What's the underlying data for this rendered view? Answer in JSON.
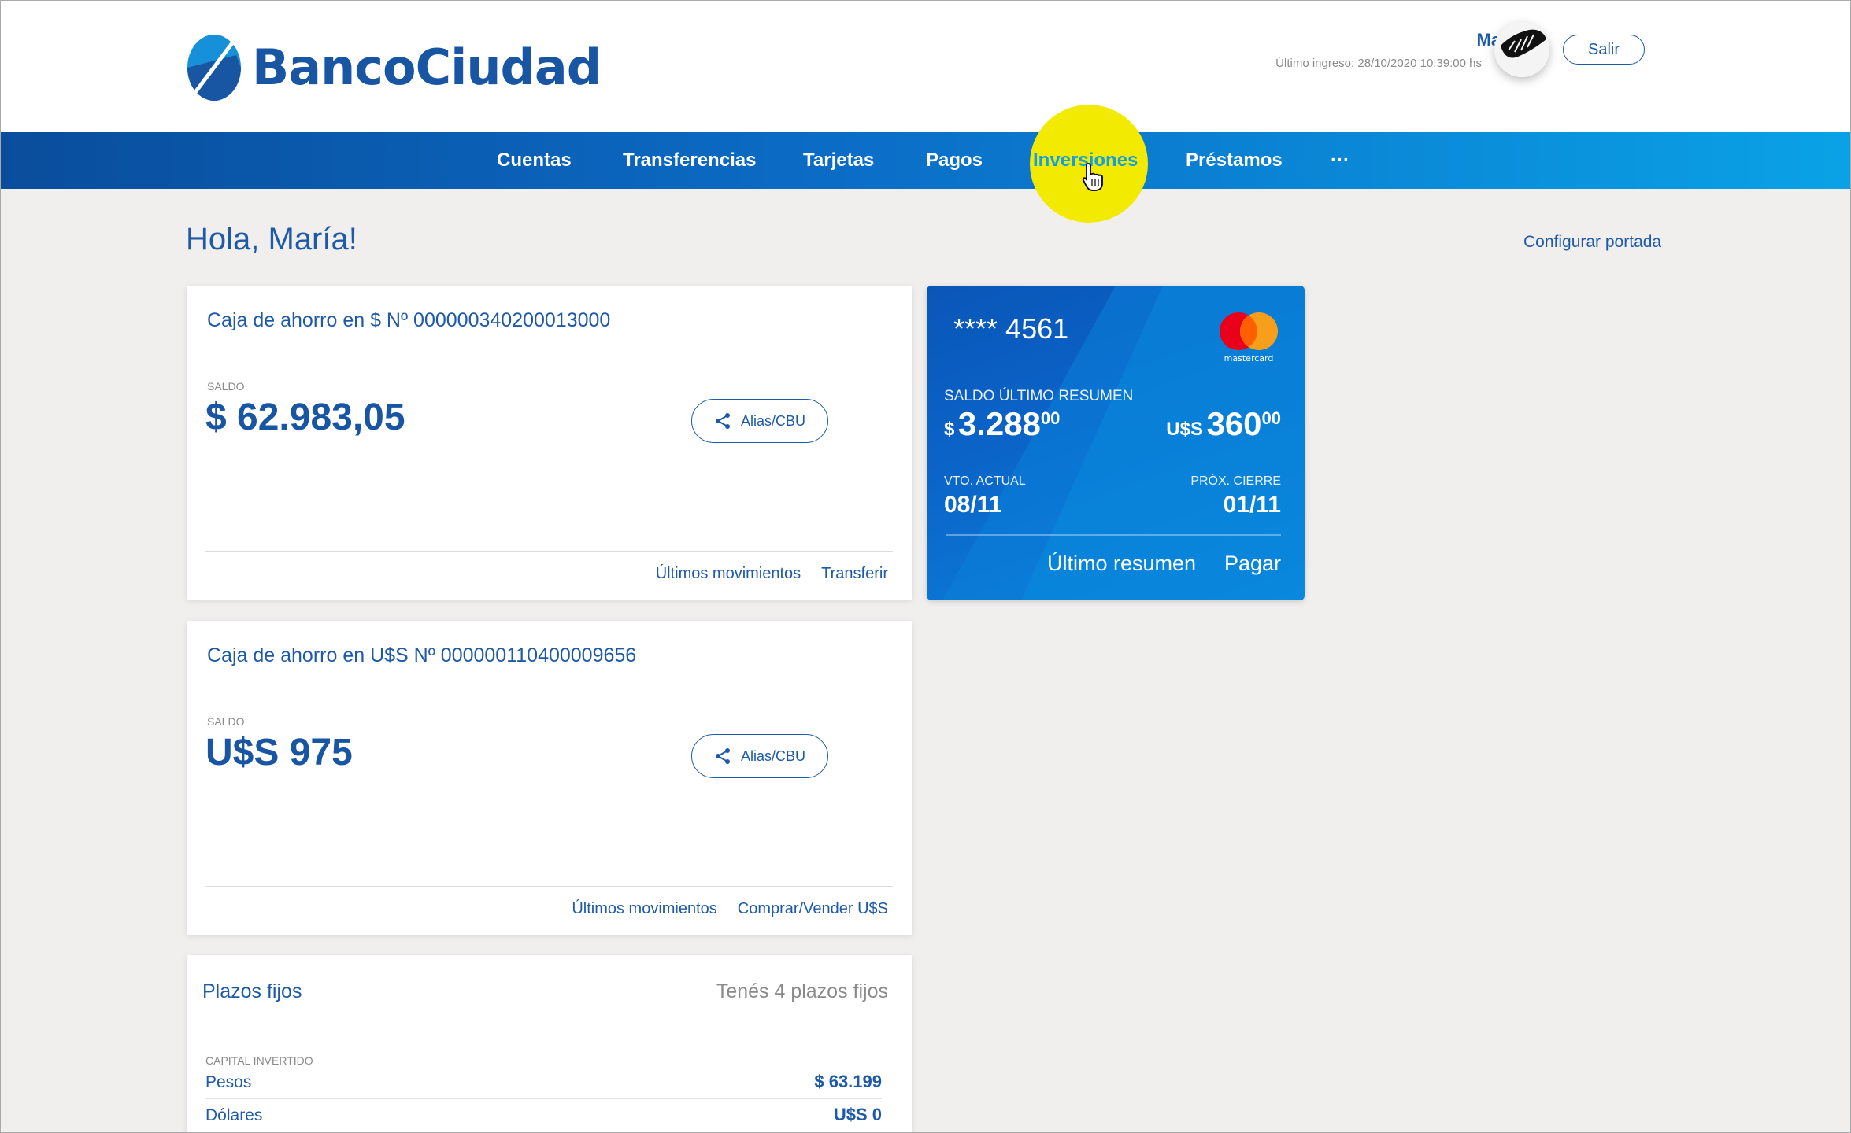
{
  "brand": {
    "name": "BancoCiudad",
    "color": "#1856a4"
  },
  "header": {
    "user_name": "María",
    "last_login": "Último ingreso: 28/10/2020 10:39:00 hs",
    "logout_label": "Salir"
  },
  "nav": {
    "items": [
      {
        "label": "Cuentas"
      },
      {
        "label": "Transferencias"
      },
      {
        "label": "Tarjetas"
      },
      {
        "label": "Pagos"
      },
      {
        "label": "Inversiones",
        "active": true
      },
      {
        "label": "Préstamos"
      },
      {
        "label": "···"
      }
    ],
    "highlight_color": "#f2ea00"
  },
  "main": {
    "greeting": "Hola, María!",
    "configure_label": "Configurar portada"
  },
  "accounts": [
    {
      "title": "Caja de ahorro en $ Nº 000000340200013000",
      "saldo_label": "SALDO",
      "saldo": "$ 62.983,05",
      "alias_label": "Alias/CBU",
      "links": [
        "Últimos movimientos",
        "Transferir"
      ]
    },
    {
      "title": "Caja de ahorro en U$S Nº 000000110400009656",
      "saldo_label": "SALDO",
      "saldo": "U$S 975",
      "alias_label": "Alias/CBU",
      "links": [
        "Últimos movimientos",
        "Comprar/Vender U$S"
      ]
    }
  ],
  "credit_card": {
    "number": "**** 4561",
    "brand": "mastercard",
    "saldo_label": "SALDO ÚLTIMO RESUMEN",
    "ars": {
      "currency": "$",
      "int": "3.288",
      "dec": "00"
    },
    "usd": {
      "currency": "U$S",
      "int": "360",
      "dec": "00"
    },
    "vto_label": "VTO. ACTUAL",
    "vto": "08/11",
    "cierre_label": "PRÓX. CIERRE",
    "cierre": "01/11",
    "link_summary": "Último resumen",
    "link_pay": "Pagar"
  },
  "fixed_terms": {
    "title": "Plazos fijos",
    "count_text": "Tenés 4 plazos fijos",
    "capital_label": "CAPITAL INVERTIDO",
    "rows": [
      {
        "label": "Pesos",
        "value": "$ 63.199"
      },
      {
        "label": "Dólares",
        "value": "U$S 0"
      }
    ]
  }
}
